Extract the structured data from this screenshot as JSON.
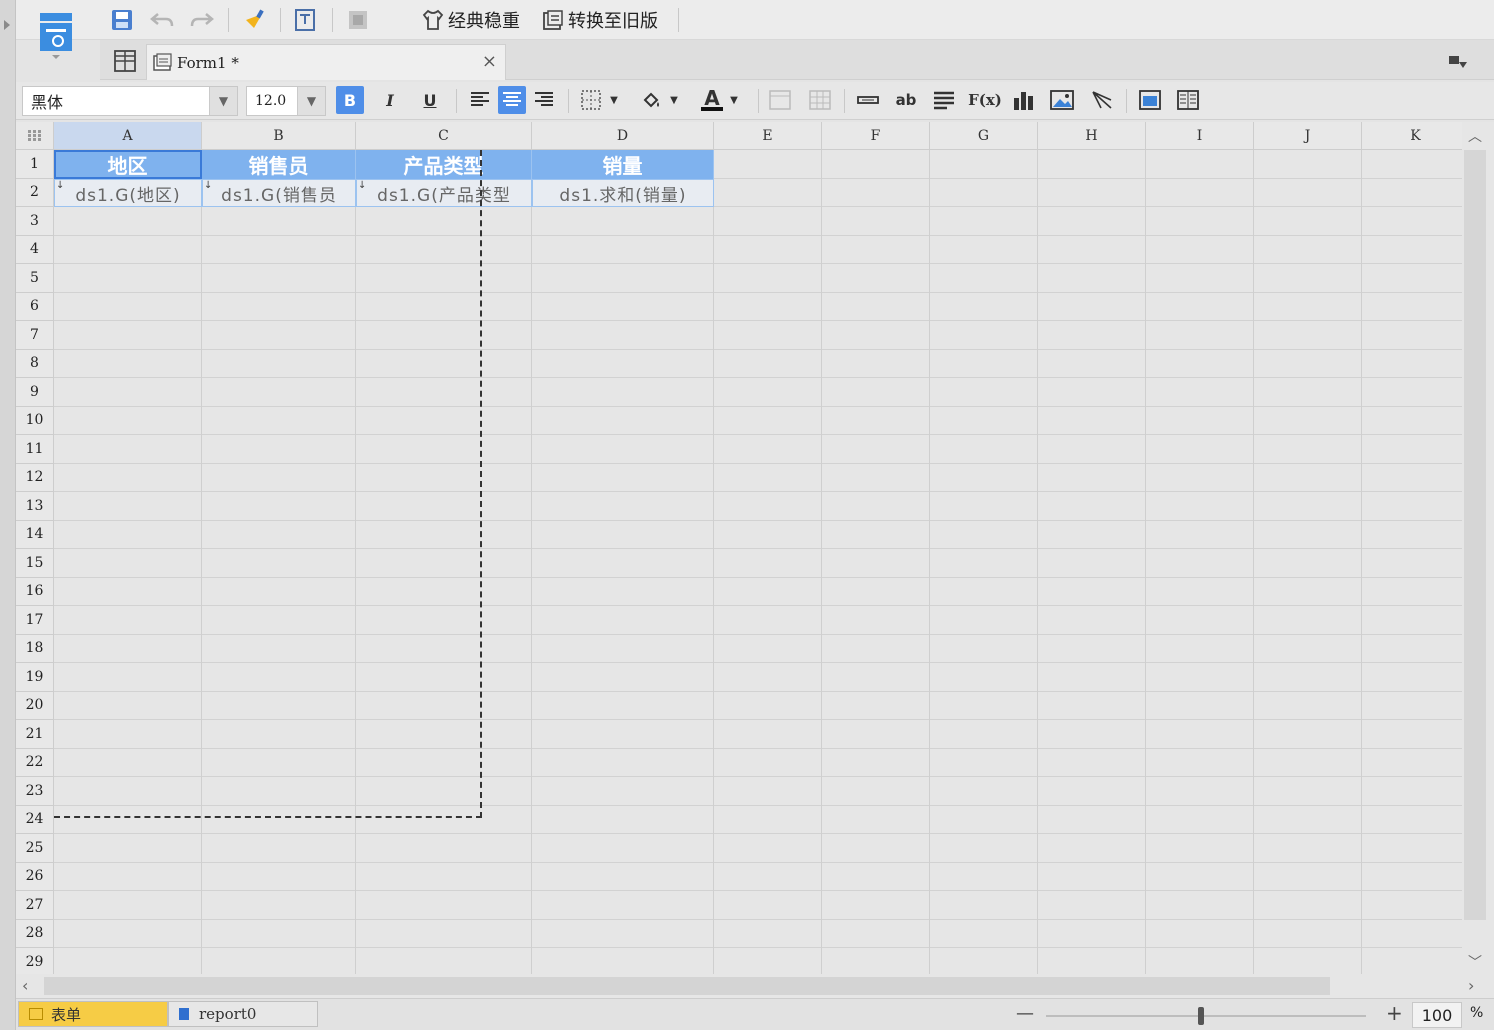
{
  "toolbar": {
    "classic_label": "经典稳重",
    "convert_label": "转换至旧版"
  },
  "tab": {
    "title": "Form1 *",
    "close": "×"
  },
  "format": {
    "font": "黑体",
    "size": "12.0",
    "bold": "B",
    "italic": "I",
    "underline": "U",
    "font_color": "A",
    "text_icon": "ab",
    "formula_icon": "F(x)"
  },
  "columns": [
    "A",
    "B",
    "C",
    "D",
    "E",
    "F",
    "G",
    "H",
    "I",
    "J",
    "K"
  ],
  "rows": [
    "1",
    "2",
    "3",
    "4",
    "5",
    "6",
    "7",
    "8",
    "9",
    "10",
    "11",
    "12",
    "13",
    "14",
    "15",
    "16",
    "17",
    "18",
    "19",
    "20",
    "21",
    "22",
    "23",
    "24",
    "25",
    "26",
    "27",
    "28",
    "29"
  ],
  "cells": {
    "header": [
      "地区",
      "销售员",
      "产品类型",
      "销量"
    ],
    "data": [
      "ds1.G(地区)",
      "ds1.G(销售员",
      "ds1.G(产品类型",
      "ds1.求和(销量)"
    ]
  },
  "sheets": {
    "form": "表单",
    "report": "report0"
  },
  "zoom": {
    "value": "100",
    "unit": "%",
    "minus": "—",
    "plus": "+"
  },
  "colors": {
    "accent": "#4f8ee8",
    "header_fill": "#7fb2ee",
    "sheet_tab_active": "#f6cc45"
  }
}
